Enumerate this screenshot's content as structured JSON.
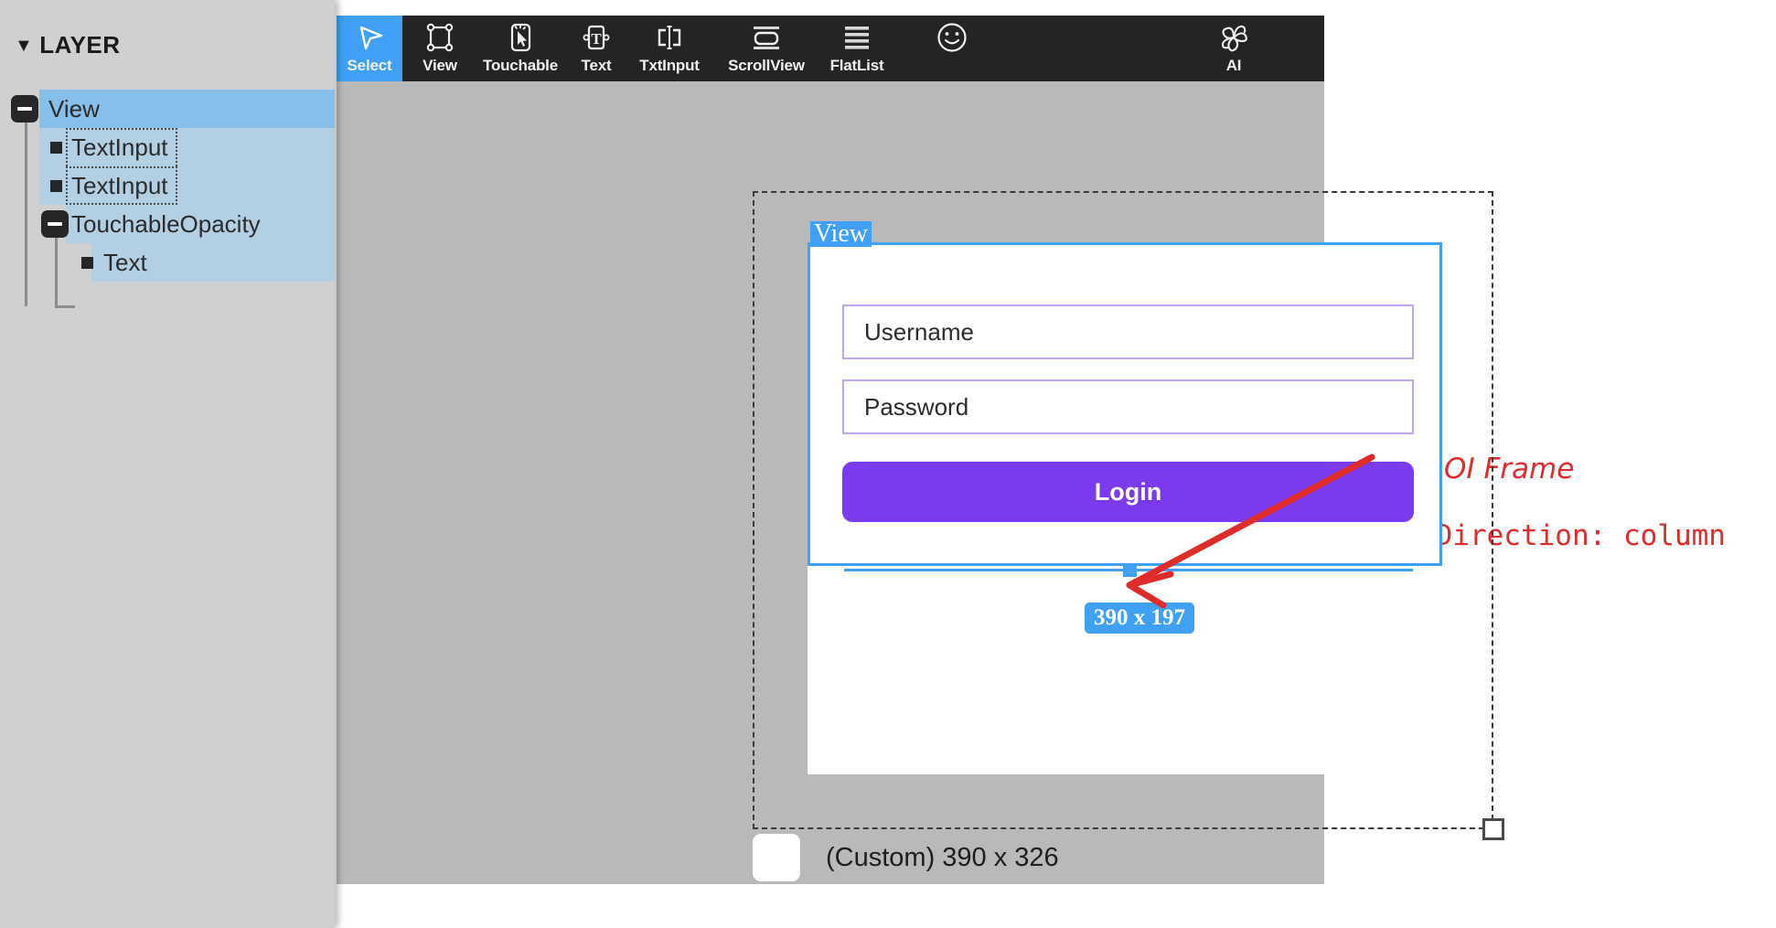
{
  "app": {
    "canvas_background": "#b9b9b9",
    "panel_background": "#d0d0d0",
    "accent_blue": "#3fa0f5",
    "accent_purple": "#7c3aed",
    "annotation_red": "#e02b2b",
    "toolbar_background": "#242424"
  },
  "layer_panel": {
    "title": "LAYER",
    "collapse_icon": "▼",
    "tree": [
      {
        "label": "View",
        "depth": 0,
        "expander": "minus-icon",
        "selected": true,
        "in_selection_group": true,
        "dotted_outline": false
      },
      {
        "label": "TextInput",
        "depth": 1,
        "expander": "bullet-icon",
        "selected": false,
        "in_selection_group": true,
        "dotted_outline": true
      },
      {
        "label": "TextInput",
        "depth": 1,
        "expander": "bullet-icon",
        "selected": false,
        "in_selection_group": true,
        "dotted_outline": true
      },
      {
        "label": "TouchableOpacity",
        "depth": 1,
        "expander": "minus-icon",
        "selected": false,
        "in_selection_group": true,
        "dotted_outline": false
      },
      {
        "label": "Text",
        "depth": 2,
        "expander": "bullet-icon",
        "selected": false,
        "in_selection_group": true,
        "dotted_outline": false
      }
    ]
  },
  "toolbar": {
    "items": [
      {
        "label": "Select",
        "icon": "cursor-arrow-icon",
        "active": true
      },
      {
        "label": "View",
        "icon": "view-frame-icon",
        "active": false
      },
      {
        "label": "Touchable",
        "icon": "touchable-tap-icon",
        "active": false
      },
      {
        "label": "Text",
        "icon": "text-t-icon",
        "active": false
      },
      {
        "label": "TxtInput",
        "icon": "text-input-icon",
        "active": false
      },
      {
        "label": "ScrollView",
        "icon": "scrollview-icon",
        "active": false
      },
      {
        "label": "FlatList",
        "icon": "flatlist-icon",
        "active": false
      },
      {
        "label": "",
        "icon": "smiley-face-icon",
        "active": false
      },
      {
        "label": "AI",
        "icon": "ai-pinwheel-icon",
        "active": false
      }
    ]
  },
  "canvas": {
    "selected_element_tag": "View",
    "fields": [
      {
        "placeholder": "Username"
      },
      {
        "placeholder": "Password"
      }
    ],
    "login_button_label": "Login",
    "size_badge": "390 x 197",
    "status_label": "(Custom) 390 x 326",
    "resize_handle": "resize-handle-bottom-right"
  },
  "annotations": {
    "title": "The ROI Frame",
    "subtitle": "flexDirection: column",
    "arrow": "arrow-pointing-left"
  }
}
